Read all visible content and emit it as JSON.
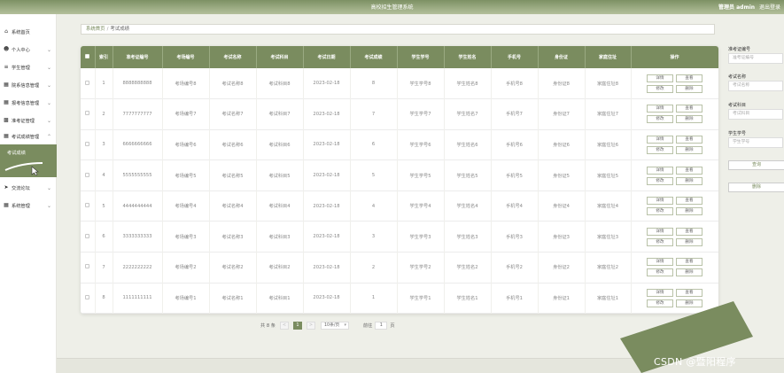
{
  "app": {
    "title": "高校招生管理系统",
    "user_label": "管理员 admin",
    "logout_label": "退出登录"
  },
  "sidebar": {
    "items": [
      {
        "label": "系统首页",
        "icon": "home-icon",
        "has_chevron": false
      },
      {
        "label": "个人中心",
        "icon": "person-icon",
        "has_chevron": true
      },
      {
        "label": "学生管理",
        "icon": "sliders-icon",
        "has_chevron": true
      },
      {
        "label": "院系信息管理",
        "icon": "grid-icon",
        "has_chevron": true
      },
      {
        "label": "报考信息管理",
        "icon": "grid-icon",
        "has_chevron": true
      },
      {
        "label": "准考证管理",
        "icon": "image-icon",
        "has_chevron": true
      },
      {
        "label": "考试成绩管理",
        "icon": "grid-icon",
        "has_chevron": true,
        "expanded": true
      },
      {
        "label": "交流论坛",
        "icon": "send-icon",
        "has_chevron": true
      },
      {
        "label": "系统管理",
        "icon": "grid-icon",
        "has_chevron": true
      }
    ],
    "active_sub": "考试成绩"
  },
  "breadcrumb": {
    "home": "系统首页",
    "current": "考试成绩"
  },
  "table": {
    "headers": [
      "索引",
      "准考证编号",
      "考场编号",
      "考试名称",
      "考试科目",
      "考试日期",
      "考试成绩",
      "学生学号",
      "学生姓名",
      "手机号",
      "身份证",
      "家庭住址",
      "操作"
    ],
    "actions": [
      "详情",
      "查看",
      "修改",
      "删除"
    ],
    "rows": [
      {
        "idx": "1",
        "ticket": "8888888888",
        "room": "考场编号8",
        "exam": "考试名称8",
        "subject": "考试科目8",
        "date": "2023-02-18",
        "score": "8",
        "sid": "学生学号8",
        "sname": "学生姓名8",
        "phone": "手机号8",
        "idcard": "身份证8",
        "addr": "家庭住址8"
      },
      {
        "idx": "2",
        "ticket": "7777777777",
        "room": "考场编号7",
        "exam": "考试名称7",
        "subject": "考试科目7",
        "date": "2023-02-18",
        "score": "7",
        "sid": "学生学号7",
        "sname": "学生姓名7",
        "phone": "手机号7",
        "idcard": "身份证7",
        "addr": "家庭住址7"
      },
      {
        "idx": "3",
        "ticket": "6666666666",
        "room": "考场编号6",
        "exam": "考试名称6",
        "subject": "考试科目6",
        "date": "2023-02-18",
        "score": "6",
        "sid": "学生学号6",
        "sname": "学生姓名6",
        "phone": "手机号6",
        "idcard": "身份证6",
        "addr": "家庭住址6"
      },
      {
        "idx": "4",
        "ticket": "5555555555",
        "room": "考场编号5",
        "exam": "考试名称5",
        "subject": "考试科目5",
        "date": "2023-02-18",
        "score": "5",
        "sid": "学生学号5",
        "sname": "学生姓名5",
        "phone": "手机号5",
        "idcard": "身份证5",
        "addr": "家庭住址5"
      },
      {
        "idx": "5",
        "ticket": "4444444444",
        "room": "考场编号4",
        "exam": "考试名称4",
        "subject": "考试科目4",
        "date": "2023-02-18",
        "score": "4",
        "sid": "学生学号4",
        "sname": "学生姓名4",
        "phone": "手机号4",
        "idcard": "身份证4",
        "addr": "家庭住址4"
      },
      {
        "idx": "6",
        "ticket": "3333333333",
        "room": "考场编号3",
        "exam": "考试名称3",
        "subject": "考试科目3",
        "date": "2023-02-18",
        "score": "3",
        "sid": "学生学号3",
        "sname": "学生姓名3",
        "phone": "手机号3",
        "idcard": "身份证3",
        "addr": "家庭住址3"
      },
      {
        "idx": "7",
        "ticket": "2222222222",
        "room": "考场编号2",
        "exam": "考试名称2",
        "subject": "考试科目2",
        "date": "2023-02-18",
        "score": "2",
        "sid": "学生学号2",
        "sname": "学生姓名2",
        "phone": "手机号2",
        "idcard": "身份证2",
        "addr": "家庭住址2"
      },
      {
        "idx": "8",
        "ticket": "1111111111",
        "room": "考场编号1",
        "exam": "考试名称1",
        "subject": "考试科目1",
        "date": "2023-02-18",
        "score": "1",
        "sid": "学生学号1",
        "sname": "学生姓名1",
        "phone": "手机号1",
        "idcard": "身份证1",
        "addr": "家庭住址1"
      }
    ]
  },
  "pagination": {
    "total": "共 8 条",
    "prev": "<",
    "page": "1",
    "next": ">",
    "page_size": "10条/页",
    "goto_label": "前往",
    "goto_value": "1",
    "page_suffix": "页"
  },
  "search": {
    "fields": [
      {
        "label": "准考证编号",
        "placeholder": "准考证编号"
      },
      {
        "label": "考试名称",
        "placeholder": "考试名称"
      },
      {
        "label": "考试科目",
        "placeholder": "考试科目"
      },
      {
        "label": "学生学号",
        "placeholder": "学生学号"
      }
    ],
    "query_label": "查询",
    "delete_label": "删除"
  },
  "watermark": "CSDN @暨阳程序",
  "colors": {
    "accent": "#7a8c5f",
    "header": "#8a9b6e"
  }
}
